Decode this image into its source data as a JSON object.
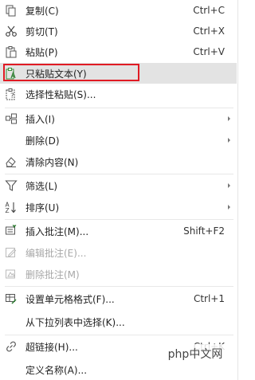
{
  "menu": {
    "items": [
      {
        "label": "复制(C)",
        "shortcut": "Ctrl+C",
        "icon": "copy-icon"
      },
      {
        "label": "剪切(T)",
        "shortcut": "Ctrl+X",
        "icon": "scissors-icon"
      },
      {
        "label": "粘贴(P)",
        "shortcut": "Ctrl+V",
        "icon": "paste-icon"
      },
      {
        "label": "只粘贴文本(Y)",
        "icon": "paste-text-icon"
      },
      {
        "label": "选择性粘贴(S)...",
        "icon": "paste-special-icon"
      },
      {
        "label": "插入(I)",
        "icon": "insert-icon"
      },
      {
        "label": "删除(D)"
      },
      {
        "label": "清除内容(N)",
        "icon": "eraser-icon"
      },
      {
        "label": "筛选(L)",
        "icon": "filter-icon"
      },
      {
        "label": "排序(U)",
        "icon": "sort-az-icon"
      },
      {
        "label": "插入批注(M)...",
        "shortcut": "Shift+F2",
        "icon": "insert-comment-icon"
      },
      {
        "label": "编辑批注(E)...",
        "icon": "edit-comment-icon"
      },
      {
        "label": "删除批注(M)",
        "icon": "delete-comment-icon"
      },
      {
        "label": "设置单元格格式(F)...",
        "shortcut": "Ctrl+1",
        "icon": "format-cells-icon"
      },
      {
        "label": "从下拉列表中选择(K)..."
      },
      {
        "label": "超链接(H)...",
        "shortcut": "Ctrl+K",
        "icon": "hyperlink-icon"
      },
      {
        "label": "定义名称(A)..."
      }
    ]
  },
  "watermark": {
    "text": "php中文网"
  },
  "colors": {
    "highlight": "#e3e3e3",
    "outline": "#e01b24"
  }
}
